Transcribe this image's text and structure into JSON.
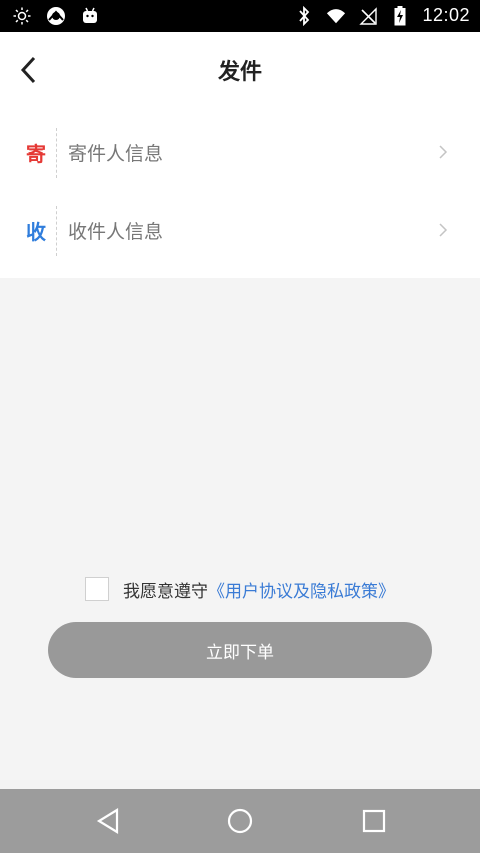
{
  "status_bar": {
    "time": "12:02",
    "left_icons": [
      "brightness-icon",
      "app-icon",
      "android-icon"
    ],
    "right_icons": [
      "bluetooth-icon",
      "wifi-icon",
      "no-signal-icon",
      "battery-charging-icon"
    ]
  },
  "header": {
    "title": "发件",
    "back_icon": "chevron-left-icon"
  },
  "sender": {
    "tag": "寄",
    "label": "寄件人信息",
    "tag_color": "#e53935"
  },
  "receiver": {
    "tag": "收",
    "label": "收件人信息",
    "tag_color": "#2f7ddc"
  },
  "agreement": {
    "text": "我愿意遵守",
    "policy_link": "《用户协议及隐私政策》",
    "checked": false
  },
  "submit": {
    "label": "立即下单"
  },
  "nav": {
    "back": "back-triangle-icon",
    "home": "home-circle-icon",
    "recents": "recents-square-icon"
  }
}
